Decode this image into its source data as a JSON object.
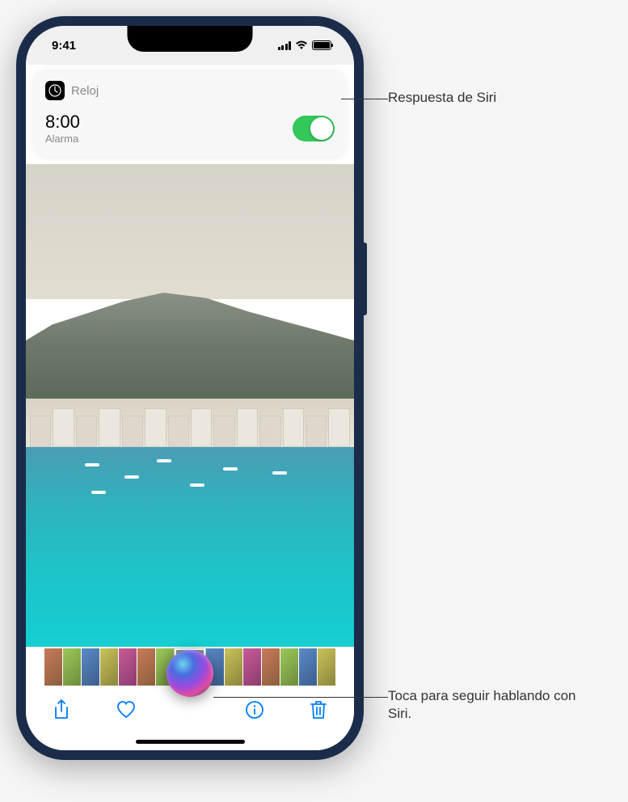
{
  "status_bar": {
    "time": "9:41"
  },
  "siri_response": {
    "app_name": "Reloj",
    "alarm_time": "8:00",
    "alarm_label": "Alarma",
    "toggle_on": true
  },
  "toolbar": {
    "share": "share-icon",
    "favorite": "heart-icon",
    "info": "info-icon",
    "delete": "trash-icon"
  },
  "callouts": {
    "siri_response": "Respuesta de Siri",
    "siri_tap": "Toca para seguir hablando con Siri."
  }
}
